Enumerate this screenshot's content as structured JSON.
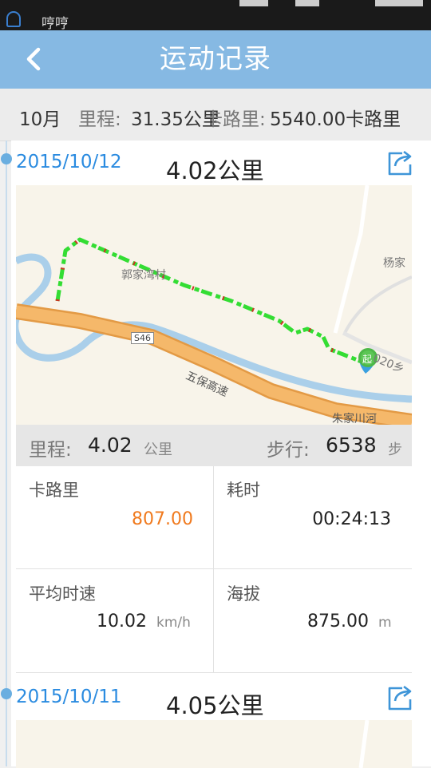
{
  "status_bar": {
    "notification_text": "哼哼"
  },
  "header": {
    "title": "运动记录"
  },
  "summary": {
    "month": "10月",
    "distance_label": "里程:",
    "distance_value": "31.35公里",
    "calories_label": "卡路里:",
    "calories_value": "5540.00卡路里"
  },
  "records": [
    {
      "date": "2015/10/12",
      "distance": "4.02公里",
      "map": {
        "labels": [
          "郭家湾村",
          "杨家",
          "S46",
          "五保高速",
          "020乡",
          "朱家川河",
          "起"
        ]
      },
      "stats": {
        "distance_label": "里程:",
        "distance_value": "4.02",
        "distance_unit": "公里",
        "steps_label": "步行:",
        "steps_value": "6538",
        "steps_unit": "步"
      },
      "details": {
        "calories_label": "卡路里",
        "calories_value": "807.00",
        "duration_label": "耗时",
        "duration_value": "00:24:13",
        "speed_label": "平均时速",
        "speed_value": "10.02",
        "speed_unit": "km/h",
        "altitude_label": "海拔",
        "altitude_value": "875.00",
        "altitude_unit": "m"
      }
    },
    {
      "date": "2015/10/11",
      "distance": "4.05公里"
    }
  ],
  "colors": {
    "title_bar": "#86b9e3",
    "date_blue": "#2a8be0",
    "calories_orange": "#f07a1e",
    "highway": "#f0b060",
    "river": "#aacfea",
    "route_green": "#33dd33"
  },
  "icons": [
    "back-arrow-icon",
    "share-icon",
    "start-marker-icon"
  ]
}
